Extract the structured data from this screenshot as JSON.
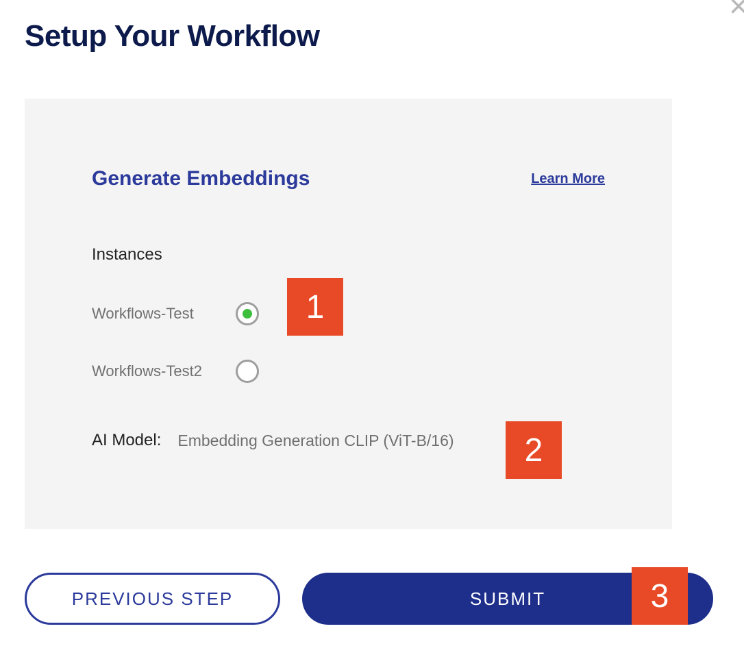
{
  "close_label": "×",
  "page_title": "Setup Your Workflow",
  "panel": {
    "title": "Generate Embeddings",
    "learn_more": "Learn More",
    "instances_label": "Instances",
    "instances": [
      {
        "name": "Workflows-Test",
        "selected": true
      },
      {
        "name": "Workflows-Test2",
        "selected": false
      }
    ],
    "ai_model_label": "AI Model:",
    "ai_model_value": "Embedding Generation CLIP (ViT-B/16)"
  },
  "buttons": {
    "previous": "PREVIOUS STEP",
    "submit": "SUBMIT"
  },
  "callouts": [
    "1",
    "2",
    "3"
  ]
}
